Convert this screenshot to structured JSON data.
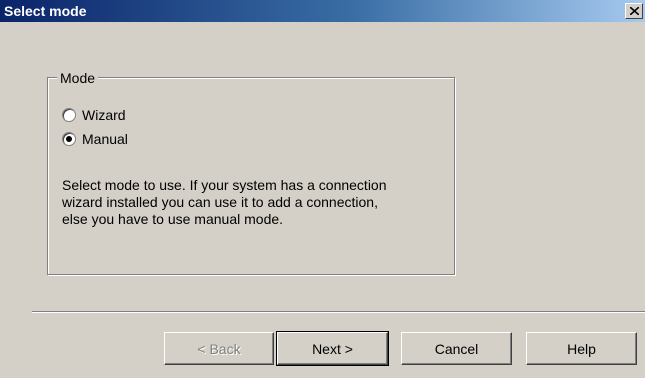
{
  "window": {
    "title": "Select mode"
  },
  "mode_group": {
    "legend": "Mode",
    "options": [
      {
        "label": "Wizard",
        "selected": false
      },
      {
        "label": "Manual",
        "selected": true
      }
    ],
    "description_lines": [
      "Select mode to use. If your system has a connection",
      "wizard installed you can use it to add a connection,",
      "else you have to use manual mode."
    ]
  },
  "buttons": {
    "back": "< Back",
    "next": "Next >",
    "cancel": "Cancel",
    "help": "Help"
  },
  "colors": {
    "title_bar_start": "#0a246a",
    "title_bar_end": "#a6caf0",
    "dialog_background": "#d4d0c8"
  },
  "icons": {
    "close": "close-icon"
  }
}
